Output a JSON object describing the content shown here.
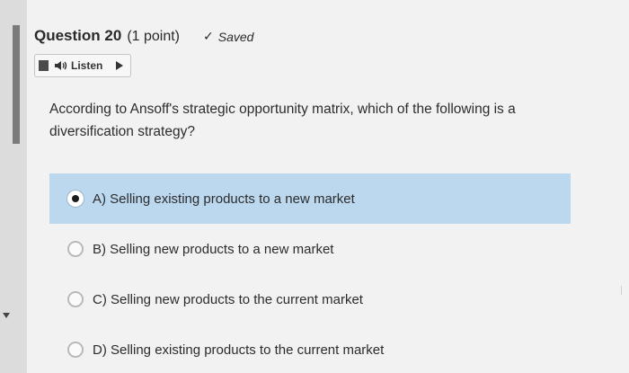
{
  "question": {
    "title": "Question 20",
    "points": "(1 point)",
    "saved_label": "Saved",
    "text": "According to Ansoff's strategic opportunity matrix, which of the following is a diversification strategy?"
  },
  "listen": {
    "label": "Listen"
  },
  "options": [
    {
      "label": "A) Selling existing products to a new market",
      "selected": true
    },
    {
      "label": "B) Selling new products to a new market",
      "selected": false
    },
    {
      "label": "C) Selling new products to the current market",
      "selected": false
    },
    {
      "label": "D) Selling existing products to the current market",
      "selected": false
    }
  ],
  "colors": {
    "selected_option_bg": "#bcd8ef",
    "page_bg": "#f2f2f2",
    "accent_bar": "#7a7a7a"
  },
  "icons": [
    "check-icon",
    "document-icon",
    "speaker-icon",
    "play-icon"
  ]
}
